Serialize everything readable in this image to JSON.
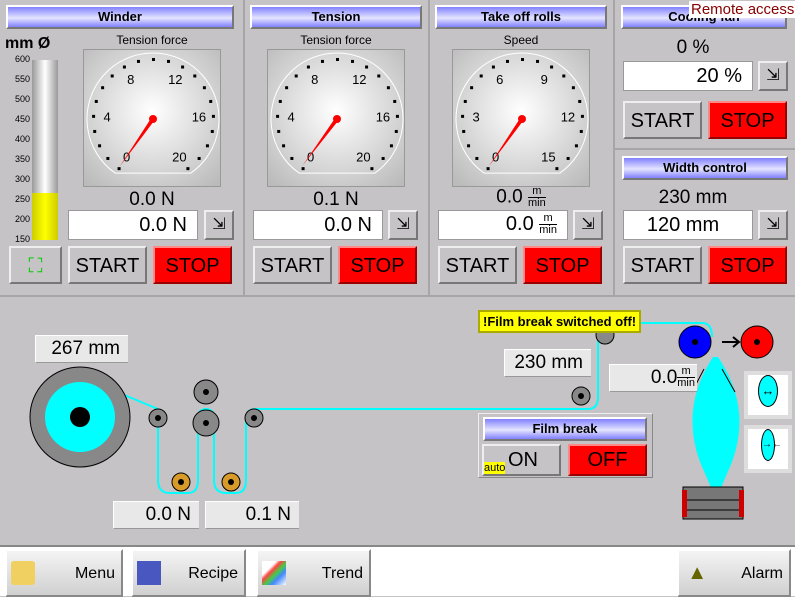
{
  "remote_access": "Remote access",
  "winder": {
    "title": "Winder",
    "diameter_unit": "mm Ø",
    "scale": [
      "600",
      "550",
      "500",
      "450",
      "400",
      "350",
      "300",
      "250",
      "200",
      "150"
    ],
    "fill_mm": 267,
    "gauge_label": "Tension force",
    "gauge_ticks": [
      "0",
      "4",
      "8",
      "12",
      "16",
      "20"
    ],
    "gauge_max": 20,
    "actual": "0.0  N",
    "setpoint": "0.0  N",
    "start": "START",
    "stop": "STOP"
  },
  "tension": {
    "title": "Tension",
    "gauge_label": "Tension force",
    "gauge_ticks": [
      "0",
      "4",
      "8",
      "12",
      "16",
      "20"
    ],
    "gauge_max": 20,
    "actual": "0.1  N",
    "setpoint": "0.0  N",
    "start": "START",
    "stop": "STOP"
  },
  "takeoff": {
    "title": "Take off rolls",
    "gauge_label": "Speed",
    "gauge_ticks": [
      "0",
      "3",
      "6",
      "9",
      "12",
      "15"
    ],
    "gauge_max": 15,
    "actual": "0.0",
    "setpoint": "0.0",
    "unit_num": "m",
    "unit_den": "min",
    "start": "START",
    "stop": "STOP"
  },
  "cooling": {
    "title": "Cooling fan",
    "actual": "0  %",
    "setpoint": "20  %",
    "start": "START",
    "stop": "STOP"
  },
  "width": {
    "title": "Width control",
    "actual": "230 mm",
    "setpoint": "120 mm",
    "start": "START",
    "stop": "STOP"
  },
  "process": {
    "roll_diameter": "267 mm",
    "tension1": "0.0 N",
    "tension2": "0.1 N",
    "width": "230 mm",
    "speed": "0.0",
    "speed_num": "m",
    "speed_den": "min",
    "warning": "!Film break switched off!"
  },
  "film_break": {
    "title": "Film break",
    "auto": "auto",
    "on": "ON",
    "off": "OFF"
  },
  "footer": {
    "menu": "Menu",
    "recipe": "Recipe",
    "trend": "Trend",
    "alarm": "Alarm"
  },
  "colors": {
    "stop": "#ff0000",
    "film": "#00ffff",
    "header": "#8080ff",
    "warning": "#ffff00"
  }
}
